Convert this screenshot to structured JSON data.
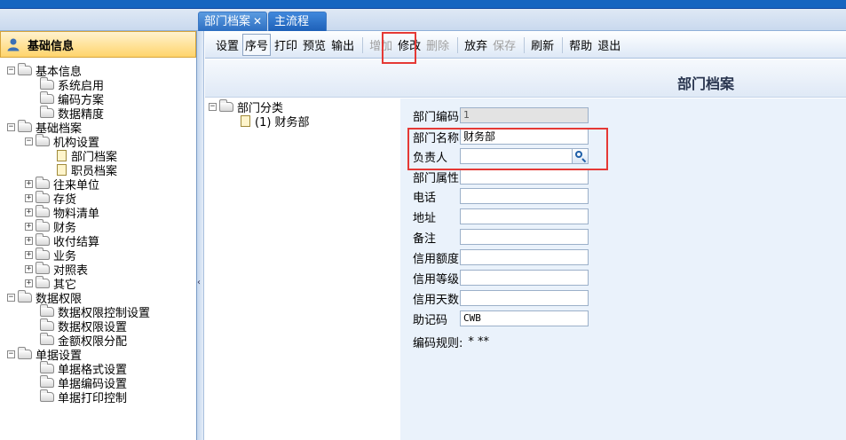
{
  "tabs": [
    {
      "label": "部门档案",
      "close": "✕"
    },
    {
      "label": "主流程"
    }
  ],
  "sidebar": {
    "title": "基础信息",
    "tree": [
      {
        "label": "基本信息",
        "exp": "−"
      },
      {
        "label": "系统启用"
      },
      {
        "label": "编码方案"
      },
      {
        "label": "数据精度"
      },
      {
        "label": "基础档案",
        "exp": "−"
      },
      {
        "label": "机构设置",
        "exp": "−"
      },
      {
        "label": "部门档案"
      },
      {
        "label": "职员档案"
      },
      {
        "label": "往来单位",
        "exp": "+"
      },
      {
        "label": "存货",
        "exp": "+"
      },
      {
        "label": "物料清单",
        "exp": "+"
      },
      {
        "label": "财务",
        "exp": "+"
      },
      {
        "label": "收付结算",
        "exp": "+"
      },
      {
        "label": "业务",
        "exp": "+"
      },
      {
        "label": "对照表",
        "exp": "+"
      },
      {
        "label": "其它",
        "exp": "+"
      },
      {
        "label": "数据权限",
        "exp": "−"
      },
      {
        "label": "数据权限控制设置"
      },
      {
        "label": "数据权限设置"
      },
      {
        "label": "金额权限分配"
      },
      {
        "label": "单据设置",
        "exp": "−"
      },
      {
        "label": "单据格式设置"
      },
      {
        "label": "单据编码设置"
      },
      {
        "label": "单据打印控制"
      }
    ]
  },
  "collapse_glyph": "‹",
  "toolbar": {
    "settings": "设置",
    "sequence": "序号",
    "print": "打印",
    "preview": "预览",
    "output": "输出",
    "add": "增加",
    "modify": "修改",
    "delete": "删除",
    "abandon": "放弃",
    "save": "保存",
    "refresh": "刷新",
    "help": "帮助",
    "exit": "退出"
  },
  "page_title": "部门档案",
  "dept_tree": {
    "root": "部门分类",
    "root_exp": "−",
    "child": "(1) 财务部"
  },
  "form": {
    "code_label": "部门编码",
    "code_value": "1",
    "name_label": "部门名称",
    "name_value": "财务部",
    "manager_label": "负责人",
    "manager_value": "",
    "attr_label": "部门属性",
    "attr_value": "",
    "phone_label": "电话",
    "phone_value": "",
    "address_label": "地址",
    "address_value": "",
    "note_label": "备注",
    "note_value": "",
    "credit_amount_label": "信用额度",
    "credit_amount_value": "",
    "credit_level_label": "信用等级",
    "credit_level_value": "",
    "credit_days_label": "信用天数",
    "credit_days_value": "",
    "mnemonic_label": "助记码",
    "mnemonic_value": "CWB",
    "rule_label": "编码规则:",
    "rule_value": "* **"
  },
  "colors": {
    "top_bar": "#1565c0",
    "highlight": "#e53935",
    "sidebar_header": "#ffd46b",
    "form_bg": "#eaf2fb"
  }
}
